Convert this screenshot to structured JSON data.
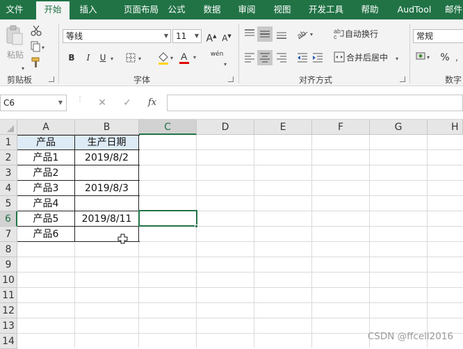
{
  "colors": {
    "brand": "#217346",
    "selection": "#217346",
    "header_fill": "#ddebf7"
  },
  "tabs": [
    "文件",
    "开始",
    "插入",
    "页面布局",
    "公式",
    "数据",
    "审阅",
    "视图",
    "开发工具",
    "帮助",
    "AudTool",
    "邮件"
  ],
  "active_tab": "开始",
  "ribbon": {
    "clipboard": {
      "paste_label": "粘贴",
      "group_label": "剪贴板"
    },
    "font": {
      "font_name": "等线",
      "font_size": "11",
      "bold": "B",
      "italic": "I",
      "underline": "U",
      "phonetic": "wén",
      "group_label": "字体"
    },
    "alignment": {
      "wrap_text": "自动换行",
      "merge_center": "合并后居中",
      "group_label": "对齐方式"
    },
    "number": {
      "format": "常规",
      "percent": "%",
      "group_label": "数字"
    }
  },
  "formula_bar": {
    "name_box": "C6",
    "fx": "fx",
    "cancel": "✕",
    "enter": "✓",
    "formula": ""
  },
  "columns": [
    "A",
    "B",
    "C",
    "D",
    "E",
    "F",
    "G",
    "H"
  ],
  "rows": [
    "1",
    "2",
    "3",
    "4",
    "5",
    "6",
    "7",
    "8",
    "9",
    "10",
    "11",
    "12",
    "13",
    "14"
  ],
  "cells": {
    "header": {
      "product": "产品",
      "production_date": "生产日期"
    },
    "data": [
      {
        "product": "产品1",
        "date": "2019/8/2"
      },
      {
        "product": "产品2",
        "date": ""
      },
      {
        "product": "产品3",
        "date": "2019/8/3"
      },
      {
        "product": "产品4",
        "date": ""
      },
      {
        "product": "产品5",
        "date": "2019/8/11"
      },
      {
        "product": "产品6",
        "date": ""
      }
    ]
  },
  "selected_cell": "C6",
  "watermark": "CSDN @ffcell2016"
}
